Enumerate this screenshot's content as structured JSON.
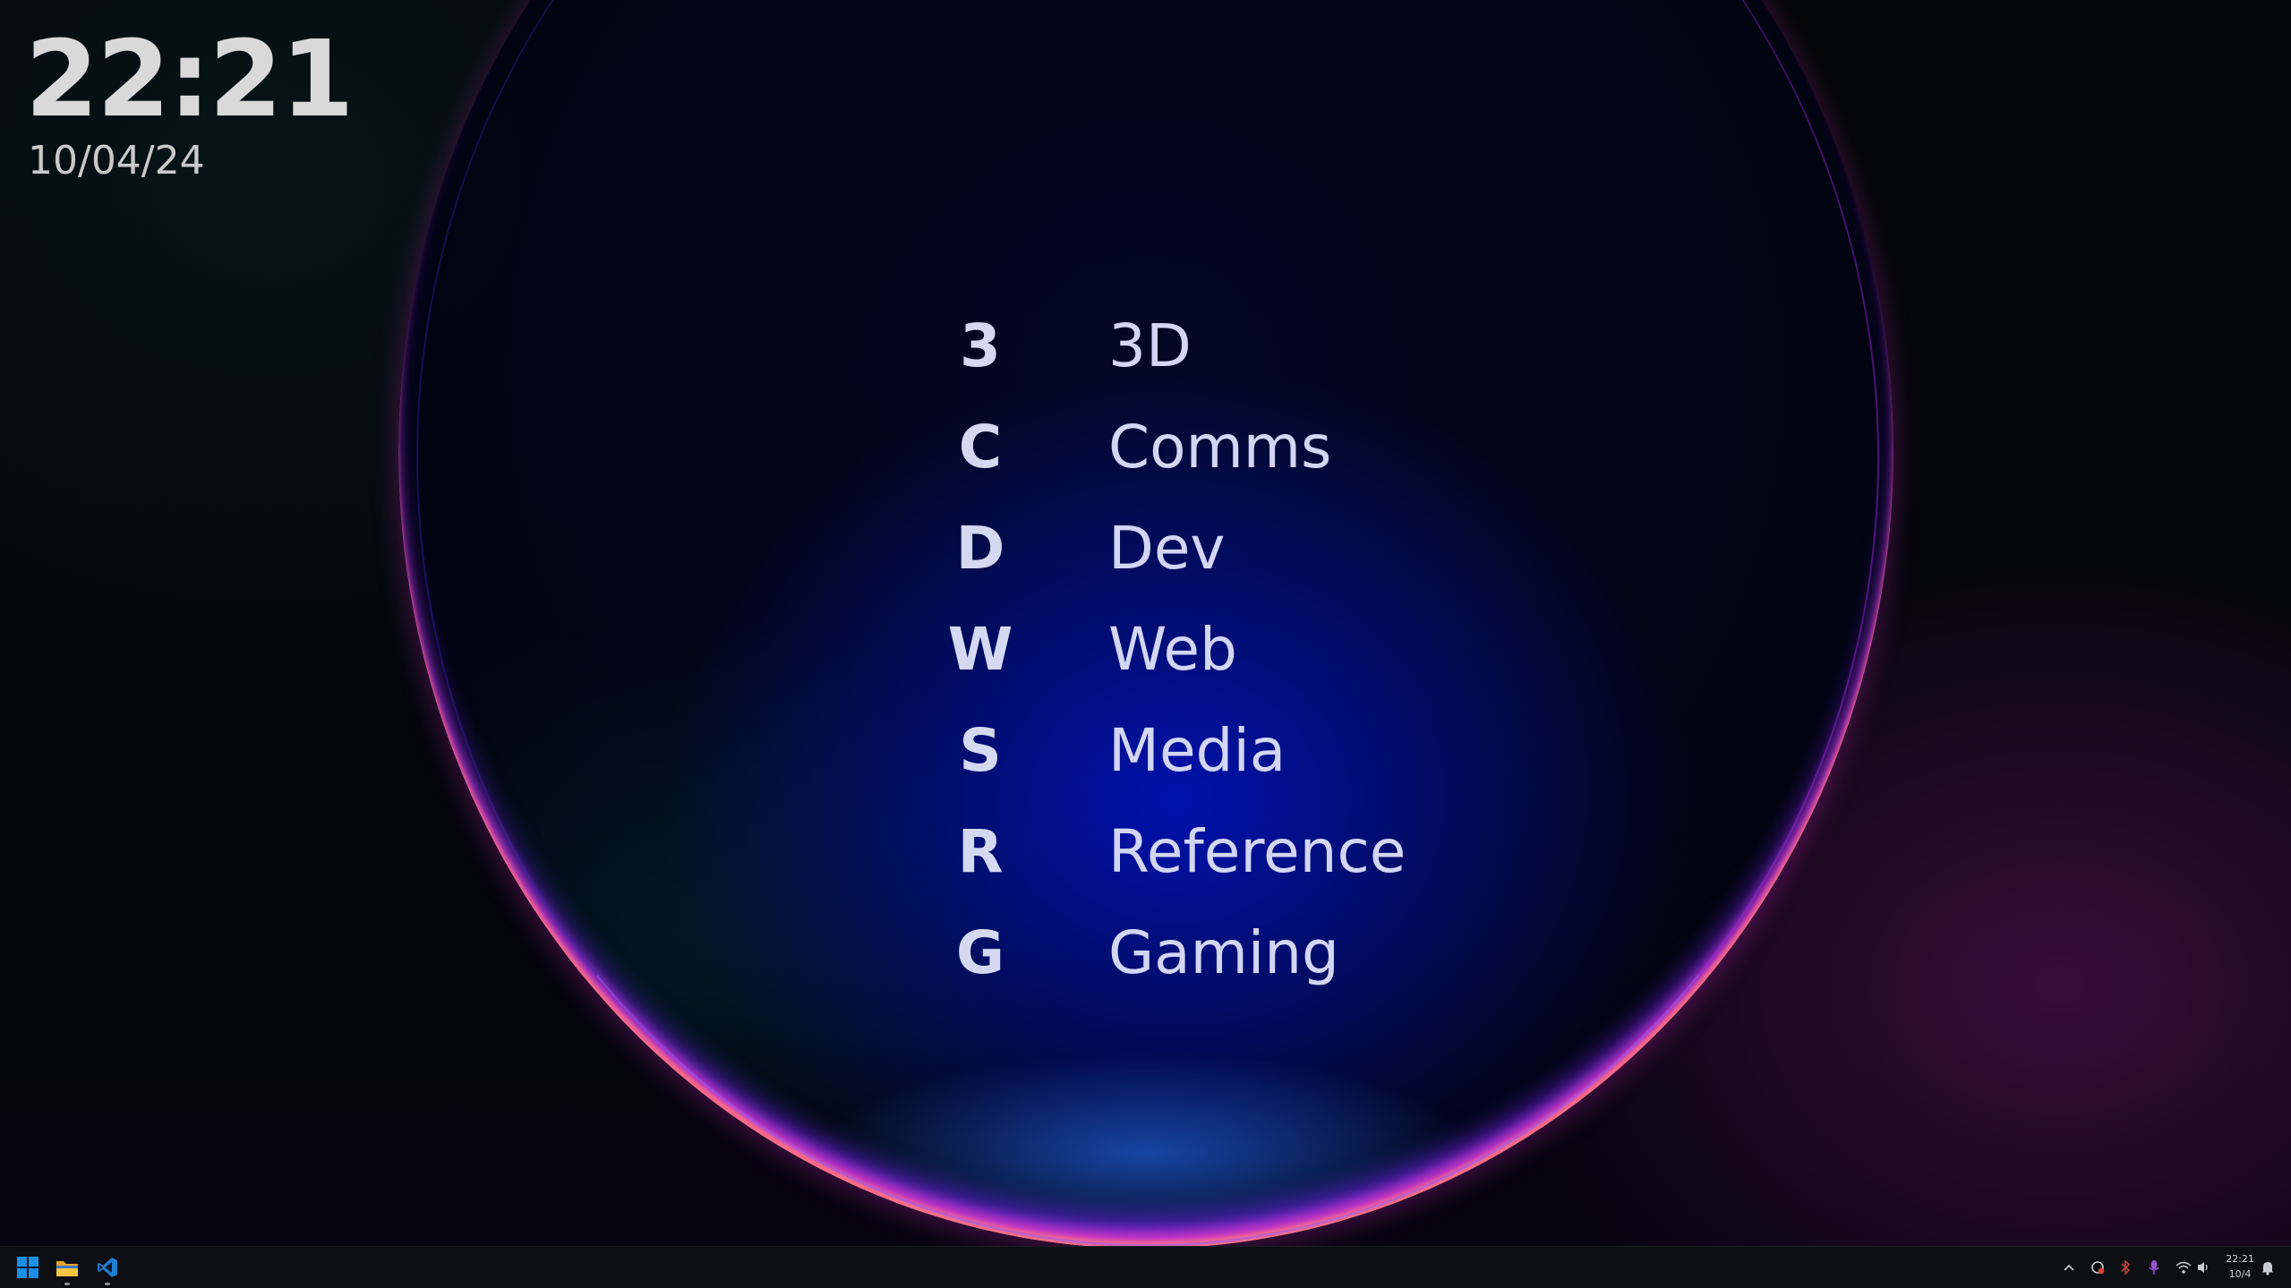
{
  "clock_widget": {
    "time": "22:21",
    "date": "10/04/24"
  },
  "launcher": {
    "items": [
      {
        "key": "3",
        "label": "3D"
      },
      {
        "key": "C",
        "label": "Comms"
      },
      {
        "key": "D",
        "label": "Dev"
      },
      {
        "key": "W",
        "label": "Web"
      },
      {
        "key": "S",
        "label": "Media"
      },
      {
        "key": "R",
        "label": "Reference"
      },
      {
        "key": "G",
        "label": "Gaming"
      }
    ]
  },
  "taskbar": {
    "pinned_apps": [
      "start-menu",
      "file-explorer",
      "visual-studio-code"
    ],
    "tray": {
      "icons": [
        "chevron-up-icon",
        "sync-icon",
        "bluetooth-icon",
        "microphone-icon",
        "wifi-icon",
        "speaker-icon",
        "notification-bell-icon"
      ],
      "time": "22:21",
      "date": "10/4"
    }
  },
  "colors": {
    "accent_blue": "#0078d4",
    "folder_yellow": "#f0b429",
    "vscode_blue": "#23a9f2"
  }
}
